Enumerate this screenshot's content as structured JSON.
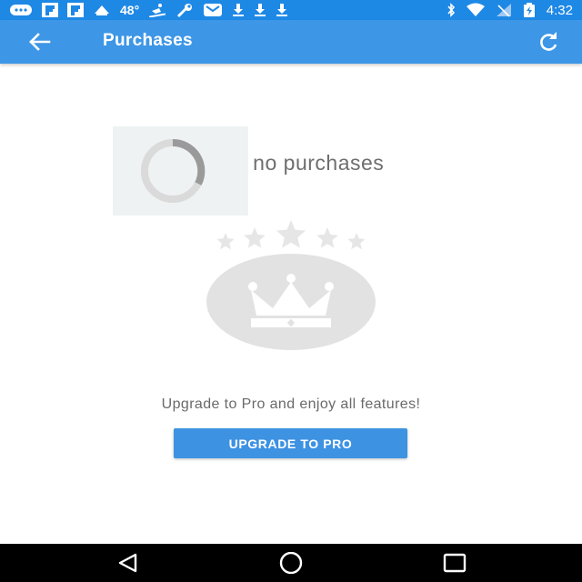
{
  "status_bar": {
    "temperature": "48°",
    "time": "4:32",
    "icons": [
      "messages-icon",
      "flipboard-icon",
      "flipboard-icon",
      "weather-icon",
      "ski-icon",
      "wrench-icon",
      "gmail-icon",
      "download-icon",
      "download-icon",
      "download-icon",
      "bluetooth-icon",
      "wifi-icon",
      "no-signal-icon",
      "battery-charging-icon"
    ]
  },
  "app_bar": {
    "title": "Purchases",
    "back_icon": "arrow-back-icon",
    "refresh_icon": "refresh-icon"
  },
  "empty_state": {
    "message": "e no purchases",
    "loader_icon": "loading-spinner-icon",
    "illustration_icon": "crown-with-stars-icon"
  },
  "upgrade": {
    "text": "Upgrade to Pro and enjoy all features!",
    "button_label": "UPGRADE TO PRO"
  },
  "colors": {
    "status_bar": "#1e88e5",
    "app_bar": "#3d96e6",
    "button": "#3d92e2",
    "illustration": "#e2e2e2"
  },
  "nav_bar": {
    "icons": [
      "nav-back-icon",
      "nav-home-icon",
      "nav-recents-icon"
    ]
  }
}
